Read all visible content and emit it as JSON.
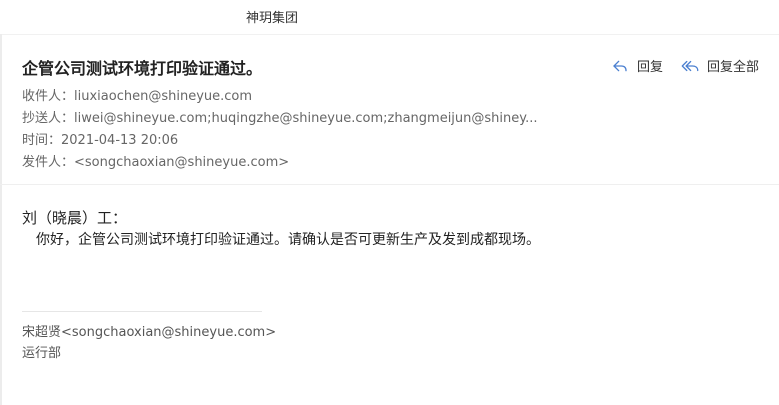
{
  "org_name": "神玥集团",
  "email": {
    "subject": "企管公司测试环境打印验证通过。",
    "actions": {
      "reply": "回复",
      "reply_all": "回复全部"
    },
    "meta": {
      "to_label": "收件人：",
      "to_value": "liuxiaochen@shineyue.com",
      "cc_label": "抄送人：",
      "cc_value": "liwei@shineyue.com;huqingzhe@shineyue.com;zhangmeijun@shiney...",
      "time_label": "时间：",
      "time_value": "2021-04-13 20:06",
      "from_label": "发件人：",
      "from_value": "<songchaoxian@shineyue.com>"
    },
    "body": {
      "salutation": "刘（晓晨）工：",
      "paragraph": "你好，企管公司测试环境打印验证通过。请确认是否可更新生产及发到成都现场。"
    },
    "signature": {
      "name_email": "宋超贤<songchaoxian@shineyue.com>",
      "department": "运行部"
    }
  },
  "icons": {
    "reply": "reply-icon",
    "reply_all": "reply-all-icon"
  },
  "colors": {
    "accent": "#4a7fd0"
  }
}
